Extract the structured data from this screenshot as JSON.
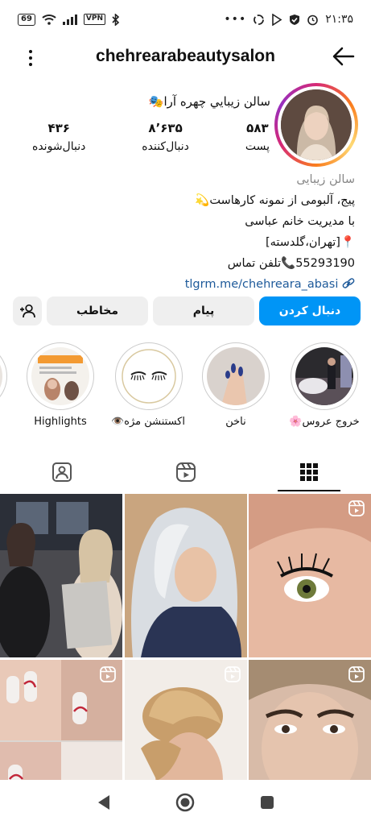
{
  "status_bar": {
    "battery": "69",
    "vpn": "VPN",
    "time": "۲۱:۳۵"
  },
  "header": {
    "username": "chehrearabeautysalon"
  },
  "profile": {
    "full_name": "سالن زيبايي چهره آرا🎭",
    "stats": [
      {
        "value": "۵۸۳",
        "label": "پست"
      },
      {
        "value": "۸٬۶۳۵",
        "label": "دنبال‌کننده"
      },
      {
        "value": "۴۳۶",
        "label": "دنبال‌شونده"
      }
    ],
    "category": "سالن زیبایی",
    "bio_lines": [
      "پیج، آلبومی از نمونه کارهاست💫",
      "با مدیریت خانم عباسی",
      "📍[تهران،گلدسته]",
      "55293190📞تلفن تماس"
    ],
    "link": "tlgrm.me/chehreara_abasi"
  },
  "actions": {
    "follow": "دنبال کردن",
    "message": "پیام",
    "contact": "مخاطب"
  },
  "highlights": [
    {
      "label": "خروج عروس🌸"
    },
    {
      "label": "ناخن"
    },
    {
      "label": "اکستنشن مژه👁️"
    },
    {
      "label": "Highlights"
    }
  ],
  "colors": {
    "accent": "#0095f6",
    "link": "#1e5a9a"
  }
}
